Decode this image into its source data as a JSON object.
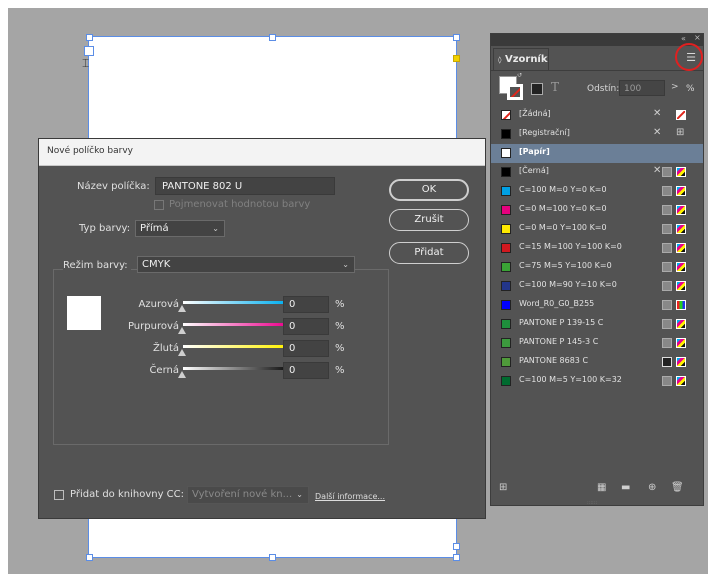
{
  "dialog": {
    "title": "Nové políčko barvy",
    "name_label": "Název políčka:",
    "name_value": "PANTONE 802 U",
    "name_by_value_label": "Pojmenovat hodnotou barvy",
    "type_label": "Typ barvy:",
    "type_value": "Přímá",
    "mode_label": "Režim barvy:",
    "mode_value": "CMYK",
    "ok_label": "OK",
    "cancel_label": "Zrušit",
    "add_label": "Přidat",
    "sliders": [
      {
        "label": "Azurová",
        "value": "0",
        "unit": "%",
        "color": "#00aeef"
      },
      {
        "label": "Purpurová",
        "value": "0",
        "unit": "%",
        "color": "#ec008c"
      },
      {
        "label": "Žlutá",
        "value": "0",
        "unit": "%",
        "color": "#fff200"
      },
      {
        "label": "Černá",
        "value": "0",
        "unit": "%",
        "color": "#111111"
      }
    ],
    "add_to_library_label": "Přidat do knihovny CC:",
    "library_value": "Vytvoření nové kn...",
    "more_info_link": "Další informace..."
  },
  "panel": {
    "tab_label": "Vzorník",
    "tint_label": "Odstín:",
    "tint_value": "100",
    "tint_unit": "%",
    "swatches": [
      {
        "name": "[Žádná]",
        "chip": "none",
        "icons": "x-none"
      },
      {
        "name": "[Registrační]",
        "chip": "#000000",
        "icons": "x-reg"
      },
      {
        "name": "[Papír]",
        "chip": "#ffffff",
        "icons": "",
        "selected": true
      },
      {
        "name": "[Černá]",
        "chip": "#000000",
        "icons": "x-cmyk"
      },
      {
        "name": "C=100 M=0 Y=0 K=0",
        "chip": "#00a0e4",
        "icons": "cmyk"
      },
      {
        "name": "C=0 M=100 Y=0 K=0",
        "chip": "#e5007e",
        "icons": "cmyk"
      },
      {
        "name": "C=0 M=0 Y=100 K=0",
        "chip": "#ffe900",
        "icons": "cmyk"
      },
      {
        "name": "C=15 M=100 Y=100 K=0",
        "chip": "#d1181f",
        "icons": "cmyk"
      },
      {
        "name": "C=75 M=5 Y=100 K=0",
        "chip": "#3aa335",
        "icons": "cmyk"
      },
      {
        "name": "C=100 M=90 Y=10 K=0",
        "chip": "#23368a",
        "icons": "cmyk"
      },
      {
        "name": "Word_R0_G0_B255",
        "chip": "#0000ff",
        "icons": "rgb"
      },
      {
        "name": "PANTONE P 139-15 C",
        "chip": "#1e8f3c",
        "icons": "cmyk"
      },
      {
        "name": "PANTONE P 145-3 C",
        "chip": "#3c9a3e",
        "icons": "cmyk"
      },
      {
        "name": "PANTONE 8683 C",
        "chip": "#4f9a3a",
        "icons": "spot"
      },
      {
        "name": "C=100 M=5 Y=100 K=32",
        "chip": "#006b2f",
        "icons": "cmyk"
      }
    ]
  },
  "colors": {
    "pasteboard": "#a5a5a5",
    "panel_bg": "#535353",
    "selection": "#6b7f97",
    "highlight_circle": "#e02020"
  }
}
